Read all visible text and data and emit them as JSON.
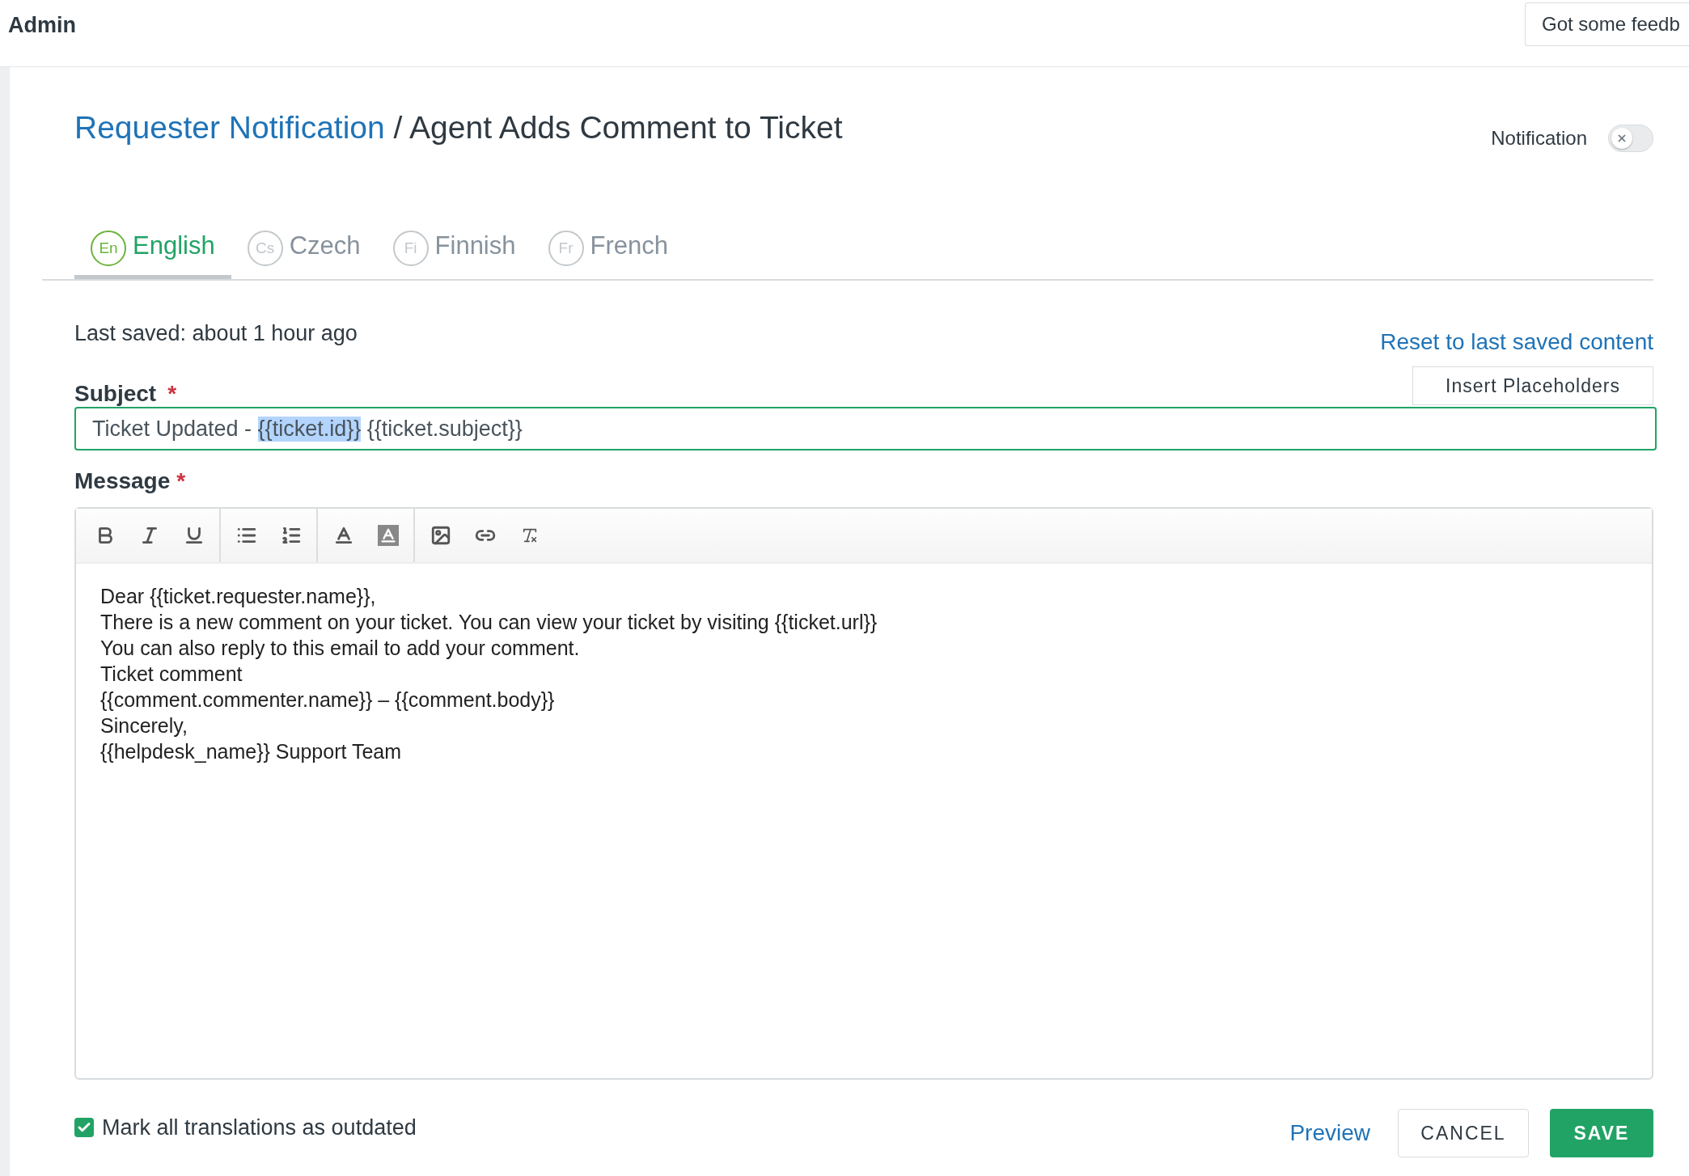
{
  "header": {
    "title": "Admin",
    "feedback_button": "Got some feedb"
  },
  "page_title": {
    "link": "Requester Notification",
    "separator": "/",
    "current": "Agent Adds Comment to Ticket"
  },
  "notification": {
    "label": "Notification",
    "on": false
  },
  "tabs": [
    {
      "code": "En",
      "label": "English",
      "selected": true
    },
    {
      "code": "Cs",
      "label": "Czech",
      "selected": false
    },
    {
      "code": "Fi",
      "label": "Finnish",
      "selected": false
    },
    {
      "code": "Fr",
      "label": "French",
      "selected": false
    }
  ],
  "last_saved": "Last saved: about 1 hour ago",
  "reset_link": "Reset to last saved content",
  "subject": {
    "label": "Subject",
    "required_mark": "*",
    "insert_button": "Insert Placeholders",
    "value_parts": [
      {
        "text": "Ticket Updated - ",
        "selected": false
      },
      {
        "text": "{{ticket.id}}",
        "selected": true
      },
      {
        "text": " {{ticket.subject}}",
        "selected": false
      }
    ]
  },
  "message": {
    "label": "Message",
    "required_mark": "*",
    "toolbar": [
      {
        "kind": "bold"
      },
      {
        "kind": "italic"
      },
      {
        "kind": "underline"
      },
      {
        "kind": "sep"
      },
      {
        "kind": "bullets"
      },
      {
        "kind": "numbers"
      },
      {
        "kind": "sep"
      },
      {
        "kind": "textcolor"
      },
      {
        "kind": "bgcolor"
      },
      {
        "kind": "sep"
      },
      {
        "kind": "image"
      },
      {
        "kind": "link"
      },
      {
        "kind": "clear"
      }
    ],
    "lines": [
      "Dear {{ticket.requester.name}},",
      "There is a new comment on your ticket. You can view your ticket by visiting {{ticket.url}}",
      "You can also reply to this email to add your comment.",
      "Ticket comment",
      "{{comment.commenter.name}} – {{comment.body}}",
      "Sincerely,",
      "{{helpdesk_name}} Support Team"
    ]
  },
  "mark_outdated": {
    "label": "Mark all translations as outdated",
    "checked": true
  },
  "actions": {
    "preview": "Preview",
    "cancel": "CANCEL",
    "save": "SAVE"
  }
}
